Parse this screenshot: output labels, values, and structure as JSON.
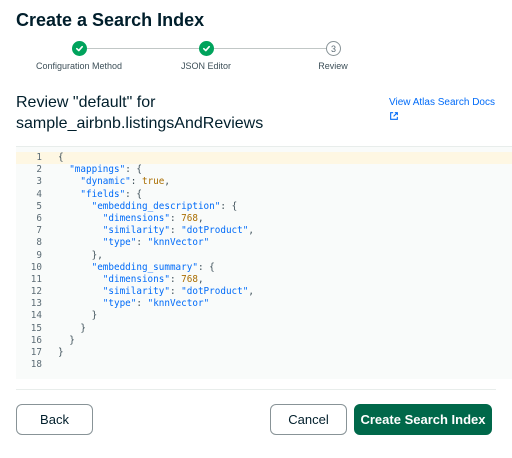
{
  "header": {
    "title": "Create a Search Index"
  },
  "stepper": {
    "steps": [
      {
        "label": "Configuration Method",
        "state": "complete",
        "icon": "check-icon"
      },
      {
        "label": "JSON Editor",
        "state": "complete",
        "icon": "check-icon"
      },
      {
        "label": "Review",
        "state": "current",
        "number": "3"
      }
    ],
    "complete_color": "#00a35c"
  },
  "review": {
    "heading_line1": "Review \"default\" for",
    "heading_line2": "sample_airbnb.listingsAndReviews",
    "docs_link": "View Atlas Search Docs",
    "docs_icon": "external-link-icon"
  },
  "editor": {
    "lines": [
      "{",
      "  \"mappings\": {",
      "    \"dynamic\": true,",
      "    \"fields\": {",
      "      \"embedding_description\": {",
      "        \"dimensions\": 768,",
      "        \"similarity\": \"dotProduct\",",
      "        \"type\": \"knnVector\"",
      "      },",
      "      \"embedding_summary\": {",
      "        \"dimensions\": 768,",
      "        \"similarity\": \"dotProduct\",",
      "        \"type\": \"knnVector\"",
      "      }",
      "    }",
      "  }",
      "}",
      ""
    ],
    "active_line": 1
  },
  "footer": {
    "back_label": "Back",
    "cancel_label": "Cancel",
    "create_label": "Create Search Index",
    "primary_color": "#00684a"
  }
}
